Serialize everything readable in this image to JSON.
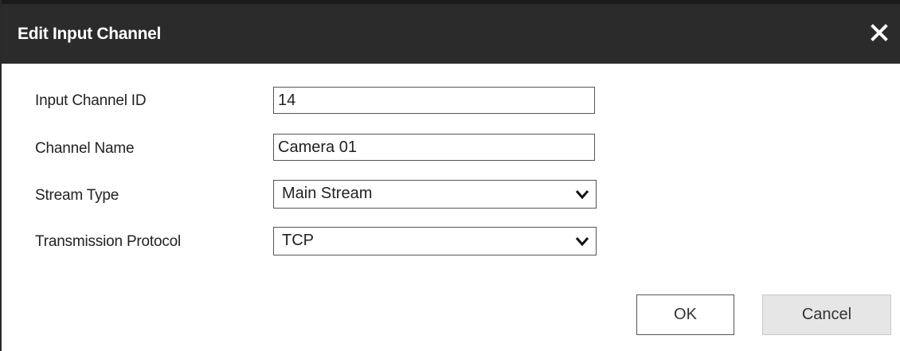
{
  "dialog": {
    "title": "Edit Input Channel",
    "close_icon": "close-icon"
  },
  "form": {
    "channel_id": {
      "label": "Input Channel ID",
      "value": "14"
    },
    "channel_name": {
      "label": "Channel Name",
      "value": "Camera 01"
    },
    "stream_type": {
      "label": "Stream Type",
      "value": "Main Stream",
      "icon": "chevron-down-icon"
    },
    "protocol": {
      "label": "Transmission Protocol",
      "value": "TCP",
      "icon": "chevron-down-icon"
    }
  },
  "buttons": {
    "ok_label": "OK",
    "cancel_label": "Cancel"
  },
  "colors": {
    "titlebar_bg": "#2b2b2b",
    "title_text": "#ffffff",
    "cancel_bg": "#e6e6e6"
  }
}
